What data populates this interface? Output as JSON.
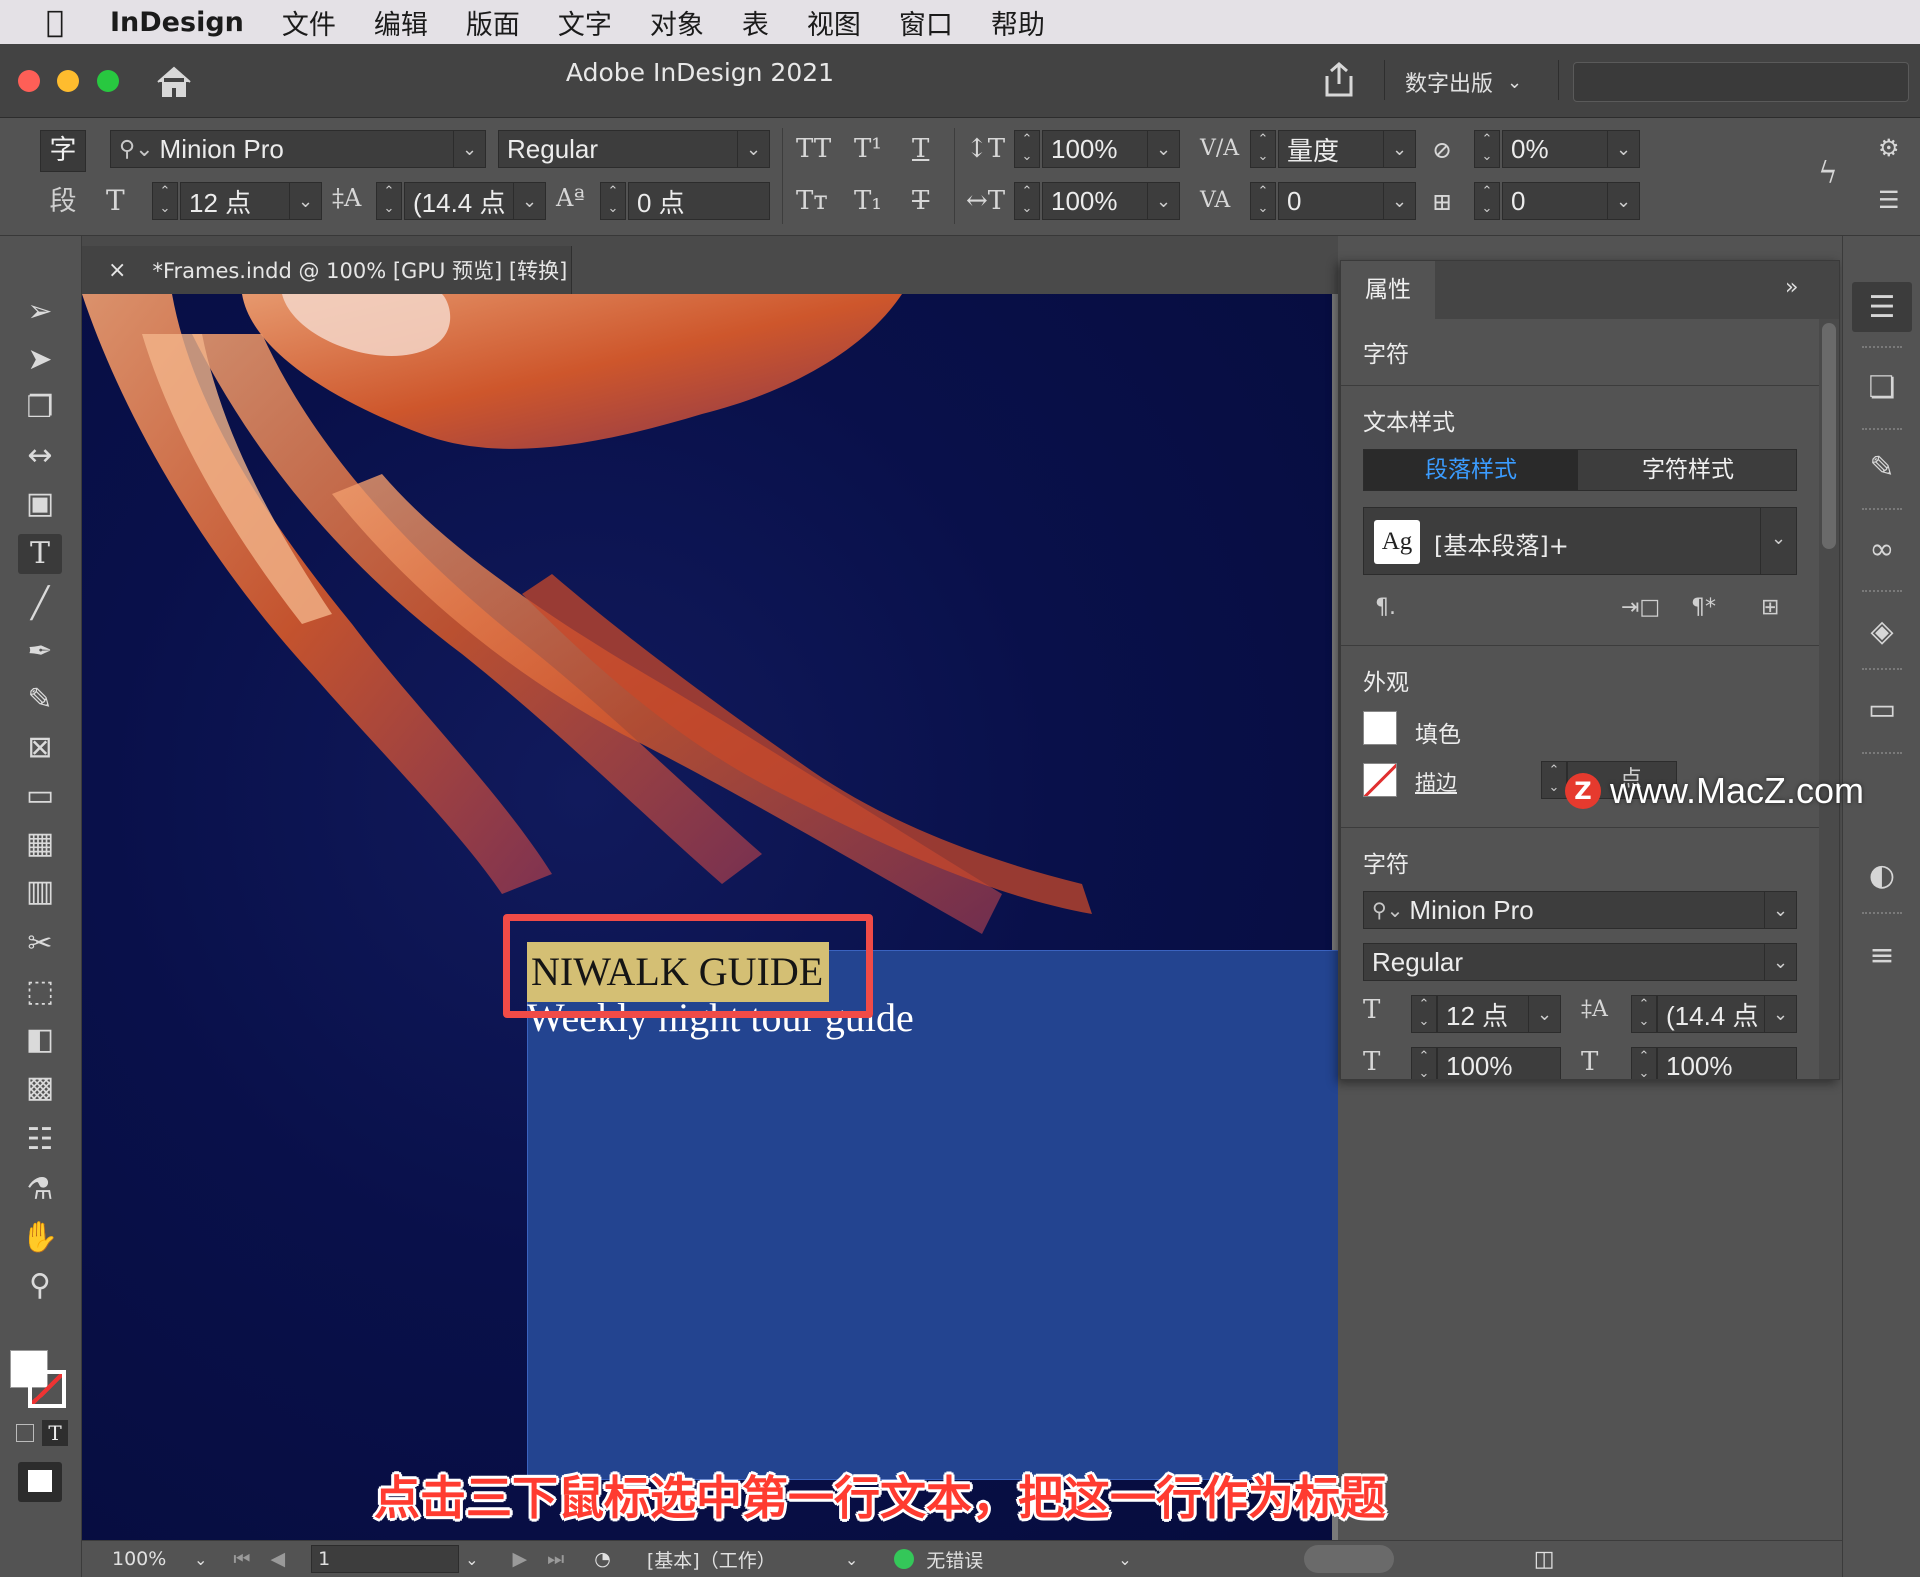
{
  "menubar": {
    "app_name": "InDesign",
    "items": [
      "文件",
      "编辑",
      "版面",
      "文字",
      "对象",
      "表",
      "视图",
      "窗口",
      "帮助"
    ]
  },
  "titlebar": {
    "title": "Adobe InDesign 2021",
    "workspace": "数字出版",
    "traffic_lights": {
      "close": "#fe5f57",
      "minimize": "#febc2e",
      "zoom": "#28c840"
    }
  },
  "control": {
    "char_mode": "字",
    "para_mode": "段",
    "font_family": "Minion Pro",
    "font_style": "Regular",
    "font_size": "12 点",
    "leading": "(14.4 点",
    "baseline_shift": "0 点",
    "vertical_scale": "100%",
    "horizontal_scale": "100%",
    "kerning": "量度",
    "tracking": "0",
    "skew": "0%",
    "char_rotation": "0"
  },
  "document_tab": {
    "close": "×",
    "title": "*Frames.indd @ 100% [GPU 预览] [转换]"
  },
  "canvas": {
    "headline": "NIWALK GUIDE",
    "subhead": "Weekly night tour guide"
  },
  "properties": {
    "tab": "属性",
    "section_character": "字符",
    "section_text_style": "文本样式",
    "seg_paragraph": "段落样式",
    "seg_character": "字符样式",
    "style_icon": "Ag",
    "style_value": "[基本段落]+",
    "section_appearance": "外观",
    "fill_label": "填色",
    "stroke_label": "描边",
    "stroke_unit": "点",
    "section_character2": "字符",
    "font_family": "Minion Pro",
    "font_style": "Regular",
    "font_size": "12 点",
    "leading": "(14.4 点",
    "scale_v": "100%",
    "scale_h": "100%"
  },
  "statusbar": {
    "zoom": "100%",
    "page": "1",
    "preflight_profile": "[基本]（工作）",
    "errors": "无错误",
    "ok_color": "#34c759"
  },
  "watermark": {
    "badge": "Z",
    "text": "www.MacZ.com"
  },
  "caption": "点击三下鼠标选中第一行文本，把这一行作为标题"
}
